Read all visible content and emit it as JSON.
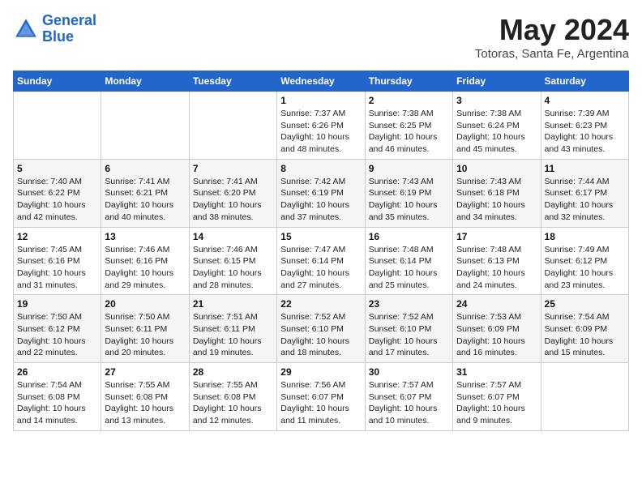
{
  "header": {
    "logo_line1": "General",
    "logo_line2": "Blue",
    "month_title": "May 2024",
    "location": "Totoras, Santa Fe, Argentina"
  },
  "weekdays": [
    "Sunday",
    "Monday",
    "Tuesday",
    "Wednesday",
    "Thursday",
    "Friday",
    "Saturday"
  ],
  "weeks": [
    [
      {
        "day": "",
        "sunrise": "",
        "sunset": "",
        "daylight": ""
      },
      {
        "day": "",
        "sunrise": "",
        "sunset": "",
        "daylight": ""
      },
      {
        "day": "",
        "sunrise": "",
        "sunset": "",
        "daylight": ""
      },
      {
        "day": "1",
        "sunrise": "Sunrise: 7:37 AM",
        "sunset": "Sunset: 6:26 PM",
        "daylight": "Daylight: 10 hours and 48 minutes."
      },
      {
        "day": "2",
        "sunrise": "Sunrise: 7:38 AM",
        "sunset": "Sunset: 6:25 PM",
        "daylight": "Daylight: 10 hours and 46 minutes."
      },
      {
        "day": "3",
        "sunrise": "Sunrise: 7:38 AM",
        "sunset": "Sunset: 6:24 PM",
        "daylight": "Daylight: 10 hours and 45 minutes."
      },
      {
        "day": "4",
        "sunrise": "Sunrise: 7:39 AM",
        "sunset": "Sunset: 6:23 PM",
        "daylight": "Daylight: 10 hours and 43 minutes."
      }
    ],
    [
      {
        "day": "5",
        "sunrise": "Sunrise: 7:40 AM",
        "sunset": "Sunset: 6:22 PM",
        "daylight": "Daylight: 10 hours and 42 minutes."
      },
      {
        "day": "6",
        "sunrise": "Sunrise: 7:41 AM",
        "sunset": "Sunset: 6:21 PM",
        "daylight": "Daylight: 10 hours and 40 minutes."
      },
      {
        "day": "7",
        "sunrise": "Sunrise: 7:41 AM",
        "sunset": "Sunset: 6:20 PM",
        "daylight": "Daylight: 10 hours and 38 minutes."
      },
      {
        "day": "8",
        "sunrise": "Sunrise: 7:42 AM",
        "sunset": "Sunset: 6:19 PM",
        "daylight": "Daylight: 10 hours and 37 minutes."
      },
      {
        "day": "9",
        "sunrise": "Sunrise: 7:43 AM",
        "sunset": "Sunset: 6:19 PM",
        "daylight": "Daylight: 10 hours and 35 minutes."
      },
      {
        "day": "10",
        "sunrise": "Sunrise: 7:43 AM",
        "sunset": "Sunset: 6:18 PM",
        "daylight": "Daylight: 10 hours and 34 minutes."
      },
      {
        "day": "11",
        "sunrise": "Sunrise: 7:44 AM",
        "sunset": "Sunset: 6:17 PM",
        "daylight": "Daylight: 10 hours and 32 minutes."
      }
    ],
    [
      {
        "day": "12",
        "sunrise": "Sunrise: 7:45 AM",
        "sunset": "Sunset: 6:16 PM",
        "daylight": "Daylight: 10 hours and 31 minutes."
      },
      {
        "day": "13",
        "sunrise": "Sunrise: 7:46 AM",
        "sunset": "Sunset: 6:16 PM",
        "daylight": "Daylight: 10 hours and 29 minutes."
      },
      {
        "day": "14",
        "sunrise": "Sunrise: 7:46 AM",
        "sunset": "Sunset: 6:15 PM",
        "daylight": "Daylight: 10 hours and 28 minutes."
      },
      {
        "day": "15",
        "sunrise": "Sunrise: 7:47 AM",
        "sunset": "Sunset: 6:14 PM",
        "daylight": "Daylight: 10 hours and 27 minutes."
      },
      {
        "day": "16",
        "sunrise": "Sunrise: 7:48 AM",
        "sunset": "Sunset: 6:14 PM",
        "daylight": "Daylight: 10 hours and 25 minutes."
      },
      {
        "day": "17",
        "sunrise": "Sunrise: 7:48 AM",
        "sunset": "Sunset: 6:13 PM",
        "daylight": "Daylight: 10 hours and 24 minutes."
      },
      {
        "day": "18",
        "sunrise": "Sunrise: 7:49 AM",
        "sunset": "Sunset: 6:12 PM",
        "daylight": "Daylight: 10 hours and 23 minutes."
      }
    ],
    [
      {
        "day": "19",
        "sunrise": "Sunrise: 7:50 AM",
        "sunset": "Sunset: 6:12 PM",
        "daylight": "Daylight: 10 hours and 22 minutes."
      },
      {
        "day": "20",
        "sunrise": "Sunrise: 7:50 AM",
        "sunset": "Sunset: 6:11 PM",
        "daylight": "Daylight: 10 hours and 20 minutes."
      },
      {
        "day": "21",
        "sunrise": "Sunrise: 7:51 AM",
        "sunset": "Sunset: 6:11 PM",
        "daylight": "Daylight: 10 hours and 19 minutes."
      },
      {
        "day": "22",
        "sunrise": "Sunrise: 7:52 AM",
        "sunset": "Sunset: 6:10 PM",
        "daylight": "Daylight: 10 hours and 18 minutes."
      },
      {
        "day": "23",
        "sunrise": "Sunrise: 7:52 AM",
        "sunset": "Sunset: 6:10 PM",
        "daylight": "Daylight: 10 hours and 17 minutes."
      },
      {
        "day": "24",
        "sunrise": "Sunrise: 7:53 AM",
        "sunset": "Sunset: 6:09 PM",
        "daylight": "Daylight: 10 hours and 16 minutes."
      },
      {
        "day": "25",
        "sunrise": "Sunrise: 7:54 AM",
        "sunset": "Sunset: 6:09 PM",
        "daylight": "Daylight: 10 hours and 15 minutes."
      }
    ],
    [
      {
        "day": "26",
        "sunrise": "Sunrise: 7:54 AM",
        "sunset": "Sunset: 6:08 PM",
        "daylight": "Daylight: 10 hours and 14 minutes."
      },
      {
        "day": "27",
        "sunrise": "Sunrise: 7:55 AM",
        "sunset": "Sunset: 6:08 PM",
        "daylight": "Daylight: 10 hours and 13 minutes."
      },
      {
        "day": "28",
        "sunrise": "Sunrise: 7:55 AM",
        "sunset": "Sunset: 6:08 PM",
        "daylight": "Daylight: 10 hours and 12 minutes."
      },
      {
        "day": "29",
        "sunrise": "Sunrise: 7:56 AM",
        "sunset": "Sunset: 6:07 PM",
        "daylight": "Daylight: 10 hours and 11 minutes."
      },
      {
        "day": "30",
        "sunrise": "Sunrise: 7:57 AM",
        "sunset": "Sunset: 6:07 PM",
        "daylight": "Daylight: 10 hours and 10 minutes."
      },
      {
        "day": "31",
        "sunrise": "Sunrise: 7:57 AM",
        "sunset": "Sunset: 6:07 PM",
        "daylight": "Daylight: 10 hours and 9 minutes."
      },
      {
        "day": "",
        "sunrise": "",
        "sunset": "",
        "daylight": ""
      }
    ]
  ]
}
